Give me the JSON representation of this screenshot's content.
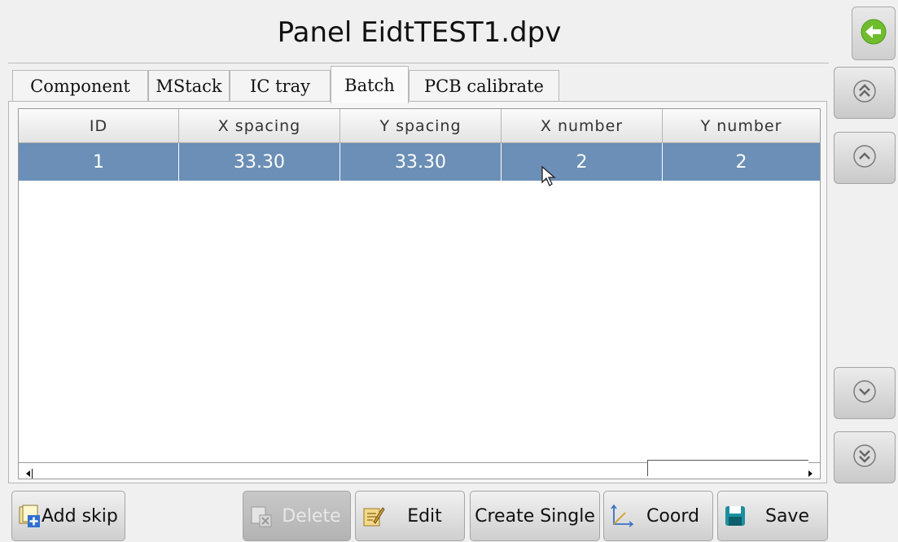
{
  "window": {
    "title": "Panel EidtTEST1.dpv"
  },
  "tabs": [
    {
      "label": "Component"
    },
    {
      "label": "MStack"
    },
    {
      "label": "IC tray"
    },
    {
      "label": "Batch",
      "active": true
    },
    {
      "label": "PCB calibrate"
    }
  ],
  "table": {
    "columns": [
      "ID",
      "X spacing",
      "Y spacing",
      "X number",
      "Y number"
    ],
    "rows": [
      {
        "id": "1",
        "x_spacing": "33.30",
        "y_spacing": "33.30",
        "x_number": "2",
        "y_number": "2",
        "selected": true
      }
    ]
  },
  "side_buttons": [
    "double-chevron-up-icon",
    "chevron-up-icon",
    "chevron-down-icon",
    "double-chevron-down-icon"
  ],
  "bottom_buttons": {
    "add_skip": "Add skip",
    "delete": "Delete",
    "edit": "Edit",
    "create_single": "Create Single",
    "coord": "Coord",
    "save": "Save"
  },
  "colors": {
    "selected_row": "#6b8fb6",
    "back_icon": "#6fbd2c",
    "background": "#f0f0f0"
  }
}
